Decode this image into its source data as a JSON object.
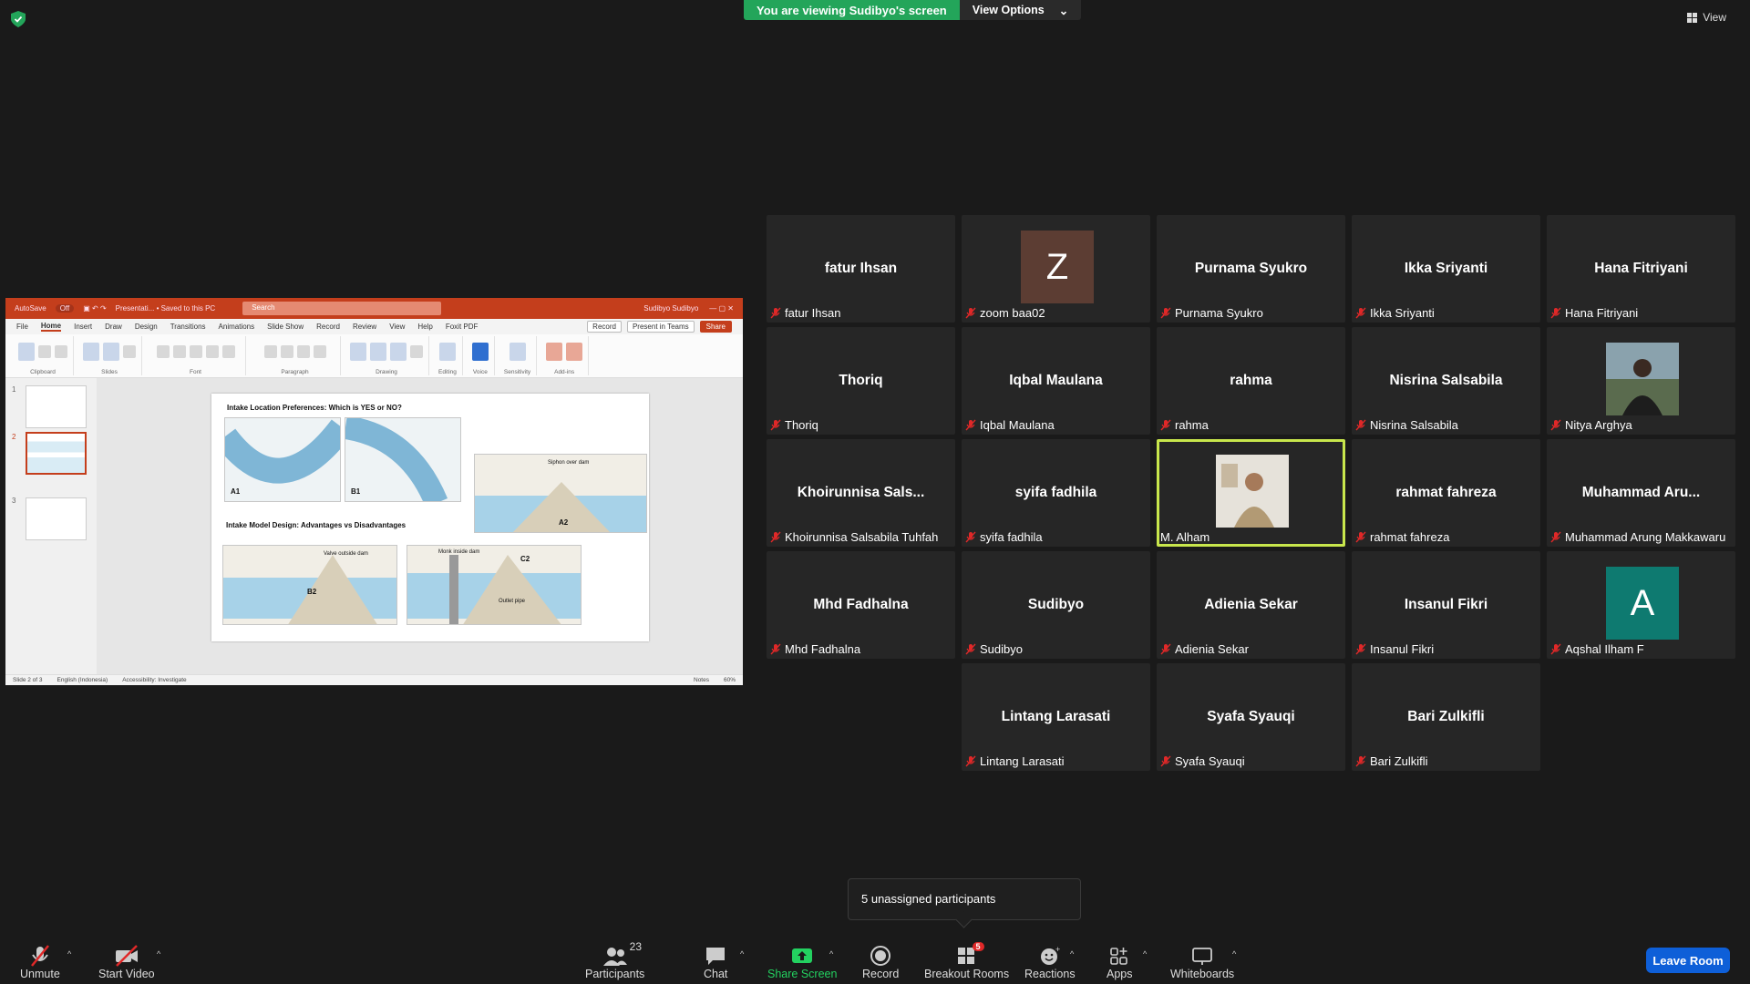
{
  "top": {
    "viewing_banner": "You are viewing Sudibyo's screen",
    "view_options": "View Options",
    "view": "View"
  },
  "shared_screen": {
    "title_bar": {
      "autosave": "AutoSave",
      "autosave_state": "Off",
      "file_name": "Presentati... • Saved to this PC",
      "search": "Search",
      "user": "Sudibyo Sudibyo"
    },
    "menu": [
      "File",
      "Home",
      "Insert",
      "Draw",
      "Design",
      "Transitions",
      "Animations",
      "Slide Show",
      "Record",
      "Review",
      "View",
      "Help",
      "Foxit PDF"
    ],
    "menu_active": "Home",
    "menu_right": {
      "record": "Record",
      "present": "Present in Teams",
      "share": "Share"
    },
    "ribbon_groups": [
      "Clipboard",
      "Slides",
      "Font",
      "Paragraph",
      "Drawing",
      "Voice",
      "Sensitivity",
      "Add-ins"
    ],
    "ribbon_buttons": {
      "paste": "Paste",
      "new_slide": "New Slide",
      "reuse": "Reuse Slides",
      "shapes": "Shapes",
      "arrange": "Arrange",
      "quick": "Quick Styles",
      "editing": "Editing",
      "dictate": "Dictate",
      "sensitivity": "Sensitivity",
      "addins": "Add-ins",
      "designer": "Designer"
    },
    "thumb_numbers": [
      "1",
      "2",
      "3"
    ],
    "slide": {
      "heading1": "Intake Location Preferences: Which is YES or NO?",
      "heading2": "Intake Model Design: Advantages vs Disadvantages",
      "labels": {
        "a1": "A1",
        "b1": "B1",
        "a2": "A2",
        "b2": "B2",
        "c2": "C2"
      },
      "captions": {
        "siphon": "Siphon over dam",
        "valve": "Valve outside dam",
        "monk": "Monk inside dam",
        "outlet": "Outlet pipe"
      }
    },
    "status": {
      "slide": "Slide 2 of 3",
      "lang": "English (Indonesia)",
      "access": "Accessibility: Investigate",
      "notes": "Notes",
      "zoom": "60%"
    }
  },
  "participants": [
    {
      "tile_name": "fatur Ihsan",
      "label": "fatur Ihsan"
    },
    {
      "tile_name": "",
      "label": "zoom baa02",
      "avatar_letter": "Z",
      "avatar_color": "#5c3d33"
    },
    {
      "tile_name": "Purnama Syukro",
      "label": "Purnama Syukro"
    },
    {
      "tile_name": "Ikka Sriyanti",
      "label": "Ikka Sriyanti"
    },
    {
      "tile_name": "Hana Fitriyani",
      "label": "Hana Fitriyani"
    },
    {
      "tile_name": "Thoriq",
      "label": "Thoriq"
    },
    {
      "tile_name": "Iqbal Maulana",
      "label": "Iqbal Maulana"
    },
    {
      "tile_name": "rahma",
      "label": "rahma"
    },
    {
      "tile_name": "Nisrina Salsabila",
      "label": "Nisrina Salsabila"
    },
    {
      "tile_name": "",
      "label": "Nitya Arghya",
      "photo": "outdoor"
    },
    {
      "tile_name": "Khoirunnisa  Sals...",
      "label": "Khoirunnisa Salsabila Tuhfah"
    },
    {
      "tile_name": "syifa fadhila",
      "label": "syifa fadhila"
    },
    {
      "tile_name": "",
      "label": "M. Alham",
      "photo": "indoor",
      "active": true
    },
    {
      "tile_name": "rahmat fahreza",
      "label": "rahmat fahreza"
    },
    {
      "tile_name": "Muhammad  Aru...",
      "label": "Muhammad Arung Makkawaru"
    },
    {
      "tile_name": "Mhd Fadhalna",
      "label": "Mhd Fadhalna"
    },
    {
      "tile_name": "Sudibyo",
      "label": "Sudibyo"
    },
    {
      "tile_name": "Adienia Sekar",
      "label": "Adienia Sekar"
    },
    {
      "tile_name": "Insanul Fikri",
      "label": "Insanul Fikri"
    },
    {
      "tile_name": "",
      "label": "Aqshal Ilham F",
      "avatar_letter": "A",
      "avatar_color": "#0e7a70"
    },
    {
      "tile_name": "Lintang Larasati",
      "label": "Lintang Larasati"
    },
    {
      "tile_name": "Syafa Syauqi",
      "label": "Syafa Syauqi"
    },
    {
      "tile_name": "Bari Zulkifli",
      "label": "Bari Zulkifli"
    }
  ],
  "unassigned": "5 unassigned participants",
  "toolbar": {
    "unmute": "Unmute",
    "start_video": "Start Video",
    "participants": "Participants",
    "participants_count": "23",
    "chat": "Chat",
    "share_screen": "Share Screen",
    "record": "Record",
    "breakout": "Breakout Rooms",
    "breakout_badge": "5",
    "reactions": "Reactions",
    "apps": "Apps",
    "whiteboards": "Whiteboards",
    "leave": "Leave Room"
  },
  "colors": {
    "green": "#23a55a",
    "leave": "#0e5fd8",
    "speaker_outline": "#c8e64c",
    "ppt_red": "#c43e1c"
  }
}
